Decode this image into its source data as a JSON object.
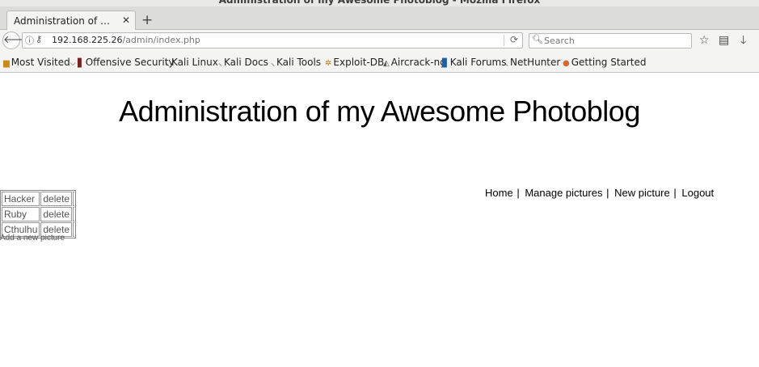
{
  "window": {
    "title": "Administration of my Awesome Photoblog - Mozilla Firefox"
  },
  "tabs": [
    {
      "label": "Administration of my Awe..."
    }
  ],
  "navbar": {
    "url_host": "192.168.225.26",
    "url_path": "/admin/index.php",
    "search_placeholder": "Search"
  },
  "bookmarks": [
    {
      "label": "Most Visited",
      "icon": "folder-icon"
    },
    {
      "label": "Offensive Security",
      "icon": "offsec-icon"
    },
    {
      "label": "Kali Linux",
      "icon": "kali-icon"
    },
    {
      "label": "Kali Docs",
      "icon": "kali-icon"
    },
    {
      "label": "Kali Tools",
      "icon": "kali-icon"
    },
    {
      "label": "Exploit-DB",
      "icon": "exploitdb-icon"
    },
    {
      "label": "Aircrack-ng",
      "icon": "aircrack-icon"
    },
    {
      "label": "Kali Forums",
      "icon": "forums-icon"
    },
    {
      "label": "NetHunter",
      "icon": "kali-icon"
    },
    {
      "label": "Getting Started",
      "icon": "firefox-icon"
    }
  ],
  "page": {
    "title": "Administration of my Awesome Photoblog",
    "nav": {
      "home": "Home",
      "manage": "Manage pictures",
      "new": "New picture",
      "logout": "Logout",
      "sep": "|"
    },
    "pictures": [
      {
        "name": "Hacker",
        "action": "delete"
      },
      {
        "name": "Ruby",
        "action": "delete"
      },
      {
        "name": "Cthulhu",
        "action": "delete"
      }
    ],
    "add_link": "Add a new picture"
  }
}
